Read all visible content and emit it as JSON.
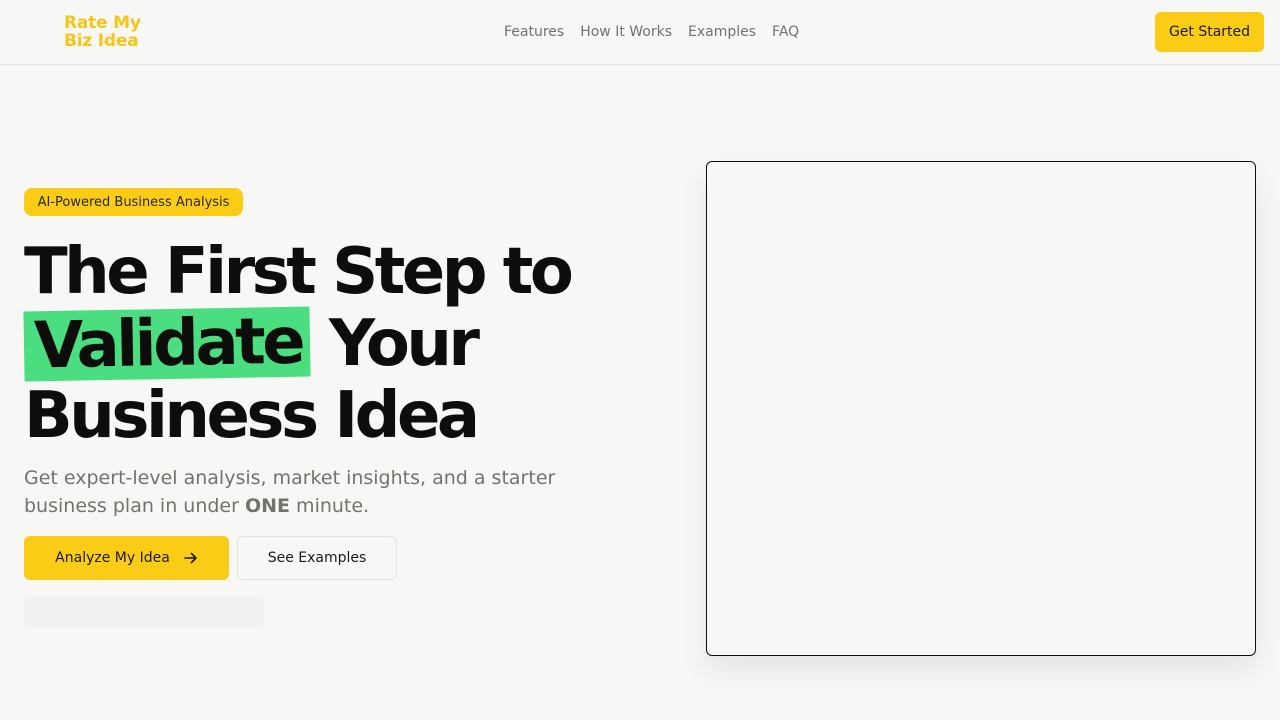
{
  "header": {
    "logo_line1": "Rate My",
    "logo_line2": "Biz Idea",
    "nav": [
      "Features",
      "How It Works",
      "Examples",
      "FAQ"
    ],
    "cta_label": "Get Started"
  },
  "hero": {
    "badge": "AI-Powered Business Analysis",
    "headline_line1": "The First Step to",
    "headline_highlight": "Validate",
    "headline_line2_rest": "Your",
    "headline_line3": "Business Idea",
    "subtitle_part1": "Get expert-level analysis, market insights, and a starter business plan in under ",
    "subtitle_bold": "ONE",
    "subtitle_part2": " minute.",
    "primary_button": "Analyze My Idea",
    "primary_button_icon": "arrow-right-icon",
    "secondary_button": "See Examples"
  },
  "colors": {
    "brand_yellow": "#facc15",
    "highlight_green": "#4ade80",
    "background": "#f7f7f6"
  }
}
